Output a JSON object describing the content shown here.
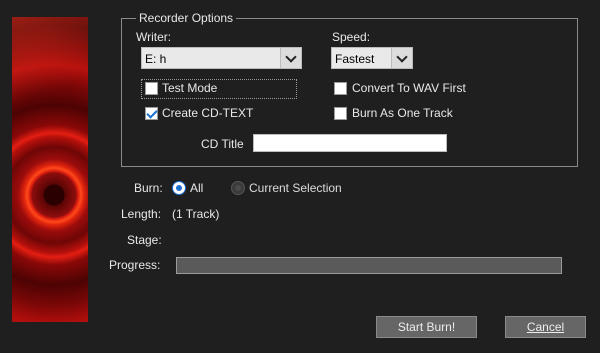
{
  "recorder_options": {
    "group_title": "Recorder Options",
    "writer_label": "Writer:",
    "writer_value": "E: h",
    "speed_label": "Speed:",
    "speed_value": "Fastest",
    "test_mode_label": "Test Mode",
    "test_mode_checked": false,
    "create_cd_text_label": "Create CD-TEXT",
    "create_cd_text_checked": true,
    "convert_wav_label": "Convert To WAV First",
    "convert_wav_checked": false,
    "burn_one_track_label": "Burn As One Track",
    "burn_one_track_checked": false,
    "cd_title_label": "CD Title",
    "cd_title_value": ""
  },
  "burn": {
    "label": "Burn:",
    "option_all": "All",
    "option_current": "Current Selection",
    "selected": "All"
  },
  "length": {
    "label": "Length:",
    "value": "(1 Track)"
  },
  "stage": {
    "label": "Stage:",
    "value": ""
  },
  "progress": {
    "label": "Progress:",
    "value": 0
  },
  "buttons": {
    "start_burn": "Start Burn!",
    "cancel": "Cancel"
  },
  "colors": {
    "accent": "#1c6fd1",
    "background": "#1f1f1f",
    "button": "#666666"
  }
}
